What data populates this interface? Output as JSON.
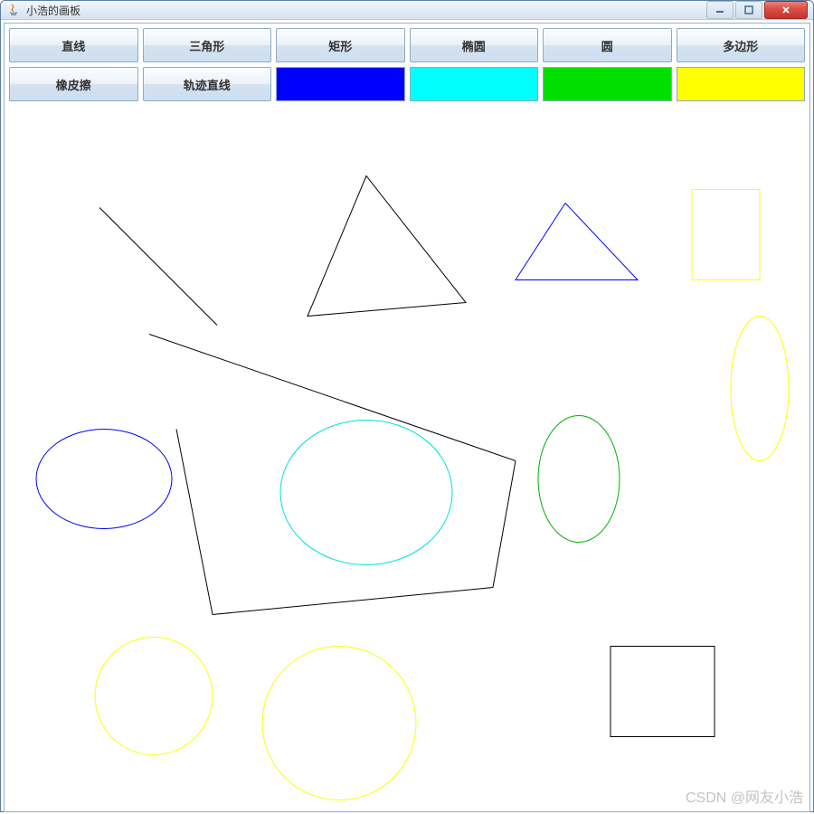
{
  "window": {
    "title": "小浩的画板"
  },
  "toolbar": {
    "row1": [
      {
        "label": "直线"
      },
      {
        "label": "三角形"
      },
      {
        "label": "矩形"
      },
      {
        "label": "椭圆"
      },
      {
        "label": "圆"
      },
      {
        "label": "多边形"
      }
    ],
    "row2_buttons": [
      {
        "label": "橡皮擦"
      },
      {
        "label": "轨迹直线"
      }
    ],
    "row2_colors": [
      {
        "hex": "#0000FF"
      },
      {
        "hex": "#00FFFF"
      },
      {
        "hex": "#00E000"
      },
      {
        "hex": "#FFFF00"
      }
    ]
  },
  "watermark": "CSDN @网友小浩"
}
